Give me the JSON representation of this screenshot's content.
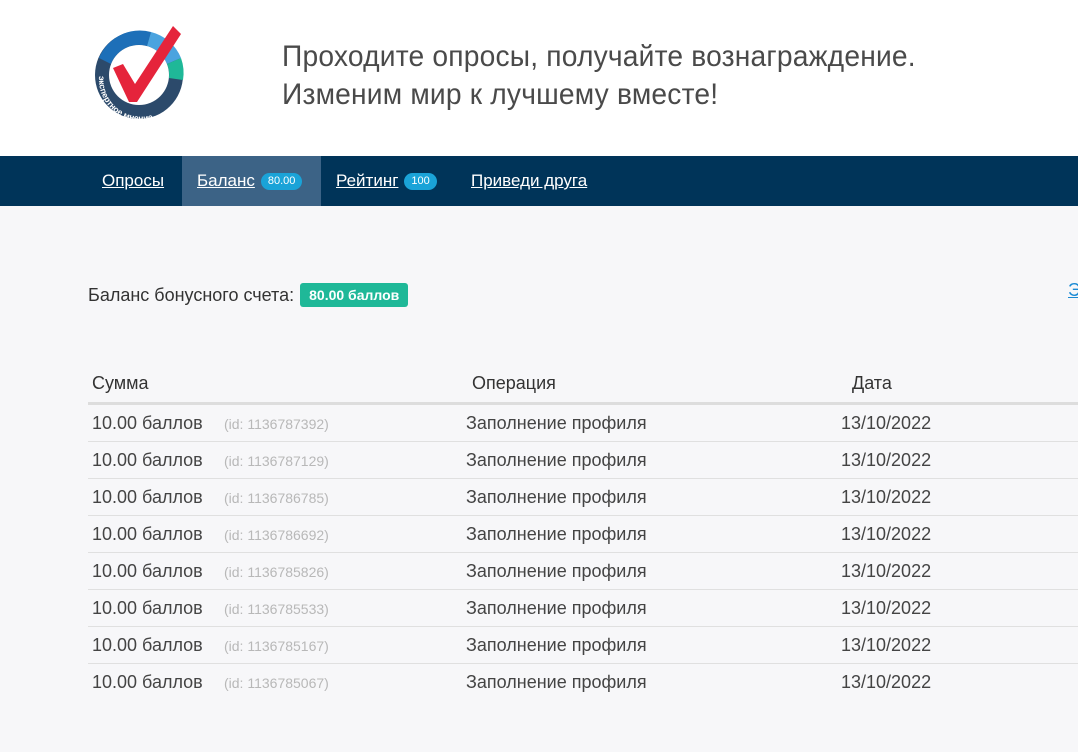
{
  "header": {
    "logo_text": "экспертное мнение",
    "tagline_line1": "Проходите опросы, получайте вознаграждение.",
    "tagline_line2": "Изменим мир к лучшему вместе!"
  },
  "nav": {
    "items": [
      {
        "label": "Опросы",
        "badge": ""
      },
      {
        "label": "Баланс",
        "badge": "80.00",
        "active": true
      },
      {
        "label": "Рейтинг",
        "badge": "100"
      },
      {
        "label": "Приведи друга",
        "badge": ""
      }
    ]
  },
  "balance": {
    "label": "Баланс бонусного счета:",
    "value": "80.00 баллов",
    "edge_link": "Э"
  },
  "table": {
    "headers": [
      "Сумма",
      "Операция",
      "Дата"
    ],
    "rows": [
      {
        "amount": "10.00 баллов",
        "id": "(id: 1136787392)",
        "operation": "Заполнение профиля",
        "date": "13/10/2022"
      },
      {
        "amount": "10.00 баллов",
        "id": "(id: 1136787129)",
        "operation": "Заполнение профиля",
        "date": "13/10/2022"
      },
      {
        "amount": "10.00 баллов",
        "id": "(id: 1136786785)",
        "operation": "Заполнение профиля",
        "date": "13/10/2022"
      },
      {
        "amount": "10.00 баллов",
        "id": "(id: 1136786692)",
        "operation": "Заполнение профиля",
        "date": "13/10/2022"
      },
      {
        "amount": "10.00 баллов",
        "id": "(id: 1136785826)",
        "operation": "Заполнение профиля",
        "date": "13/10/2022"
      },
      {
        "amount": "10.00 баллов",
        "id": "(id: 1136785533)",
        "operation": "Заполнение профиля",
        "date": "13/10/2022"
      },
      {
        "amount": "10.00 баллов",
        "id": "(id: 1136785167)",
        "operation": "Заполнение профиля",
        "date": "13/10/2022"
      },
      {
        "amount": "10.00 баллов",
        "id": "(id: 1136785067)",
        "operation": "Заполнение профиля",
        "date": "13/10/2022"
      }
    ]
  },
  "colors": {
    "navbar": "#003459",
    "nav_active": "#3c6386",
    "nav_badge": "#1aa3d8",
    "balance_badge": "#1fb898",
    "logo_check": "#e5243b",
    "logo_ring": "#1d6fb8",
    "logo_accent": "#1fb898"
  }
}
